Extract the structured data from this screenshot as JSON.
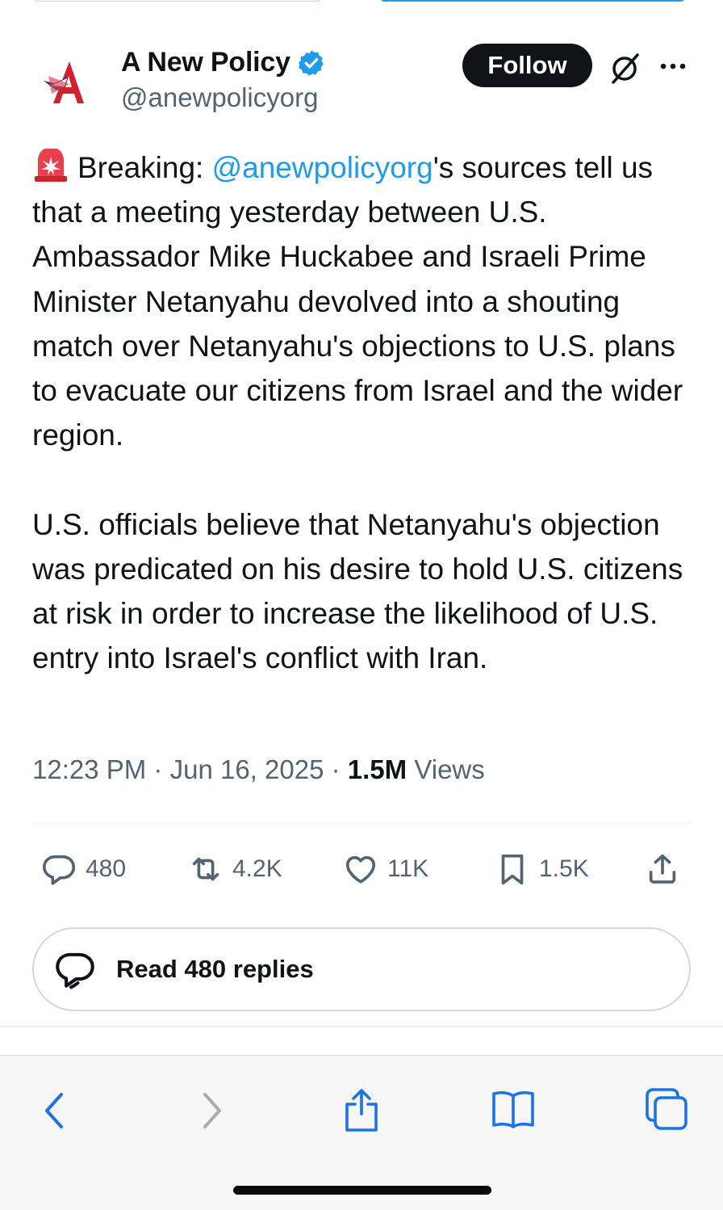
{
  "account": {
    "display_name": "A New Policy",
    "handle": "@anewpolicyorg",
    "verified": true,
    "avatar_icon": "red-A-logo"
  },
  "header": {
    "follow_label": "Follow",
    "grok_icon": "slashed-circle-icon",
    "more_icon": "more-dots-icon"
  },
  "tweet": {
    "emoji": "rotating-light",
    "prefix": "Breaking: ",
    "mention": "@anewpolicyorg",
    "paragraph1_rest": "'s sources tell us that a meeting yesterday between U.S. Ambassador Mike Huckabee and Israeli Prime Minister Netanyahu devolved into a shouting match over Netanyahu's objections to U.S. plans to evacuate our citizens from Israel and the wider region.",
    "paragraph2": "U.S. officials believe that Netanyahu's objection was predicated on his desire to hold U.S. citizens at risk in order to increase the likelihood of U.S. entry into Israel's conflict with Iran."
  },
  "meta": {
    "time": "12:23 PM",
    "date": "Jun 16, 2025",
    "views_count": "1.5M",
    "views_label": "Views"
  },
  "actions": {
    "replies": "480",
    "reposts": "4.2K",
    "likes": "11K",
    "bookmarks": "1.5K"
  },
  "read_replies_label": "Read 480 replies",
  "colors": {
    "accent": "#1d9bf0",
    "text": "#0f1419",
    "muted": "#536471",
    "safari_blue": "#1a73e8"
  }
}
